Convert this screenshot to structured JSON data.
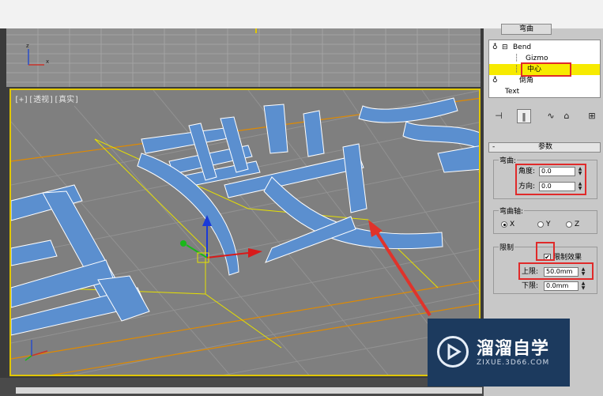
{
  "viewport": {
    "label": "[+][透视][真实]"
  },
  "panel": {
    "title_button": "弯曲",
    "stack": [
      {
        "label": "Bend",
        "prefix": "⊟"
      },
      {
        "label": "Gizmo",
        "prefix": "┆"
      },
      {
        "label": "中心",
        "prefix": "┆"
      },
      {
        "label": "倒角",
        "prefix": ""
      },
      {
        "label": "Text",
        "prefix": ""
      }
    ],
    "rollout_title": "参数",
    "bend_group": {
      "title": "弯曲:",
      "angle_label": "角度:",
      "angle_value": "0.0",
      "direction_label": "方向:",
      "direction_value": "0.0"
    },
    "axis_group": {
      "title": "弯曲轴:",
      "options": [
        "X",
        "Y",
        "Z"
      ],
      "selected": "X"
    },
    "limit_group": {
      "title": "限制",
      "limit_effect_label": "限制效果",
      "limit_effect_checked": true,
      "upper_label": "上限:",
      "upper_value": "50.0mm",
      "lower_label": "下限:",
      "lower_value": "0.0mm"
    }
  },
  "watermark": {
    "title": "溜溜自学",
    "subtitle": "ZIXUE.3D66.COM"
  },
  "colors": {
    "selection_yellow": "#f7ea00",
    "highlight_red": "#e02a2a",
    "viewport_border": "#e0c600",
    "mesh_blue": "#5b8fcf"
  }
}
